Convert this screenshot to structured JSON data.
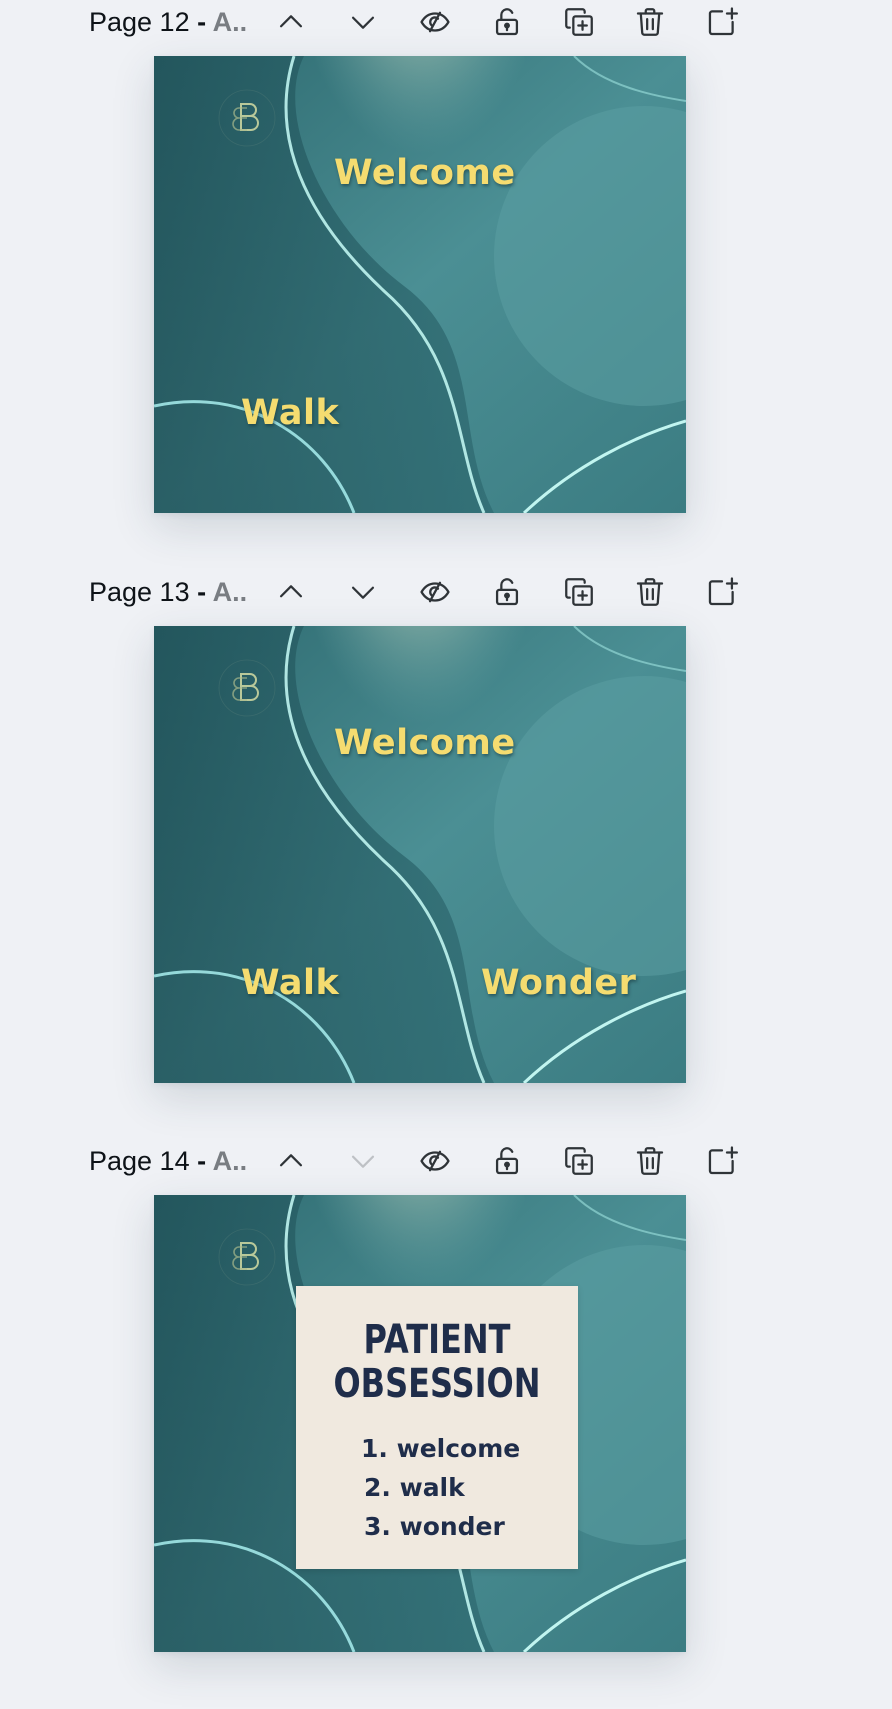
{
  "colors": {
    "background": "#eff1f5",
    "icon": "#2f3438",
    "icon_disabled": "#c4c7cb",
    "slide_text": "#f5dc70",
    "card_bg": "#f0e9df",
    "card_text": "#1f2d4a",
    "teal_dark": "#2f6b72",
    "teal_light": "#5fa3a8"
  },
  "icons": {
    "move_up": "chevron-up-icon",
    "move_down": "chevron-down-icon",
    "hide": "eye-slash-icon",
    "lock": "lock-open-icon",
    "duplicate": "duplicate-icon",
    "delete": "trash-icon",
    "add": "add-page-icon"
  },
  "pages": [
    {
      "label": "Page 12",
      "separator": " - ",
      "name": "A..",
      "move_down_disabled": false,
      "slide": {
        "welcome": "Welcome",
        "walk": "Walk",
        "wonder": ""
      }
    },
    {
      "label": "Page 13",
      "separator": " - ",
      "name": "A..",
      "move_down_disabled": false,
      "slide": {
        "welcome": "Welcome",
        "walk": "Walk",
        "wonder": "Wonder"
      }
    },
    {
      "label": "Page 14",
      "separator": " - ",
      "name": "A..",
      "move_down_disabled": true,
      "slide": {
        "card_title_line1": "PATIENT",
        "card_title_line2": "OBSESSION",
        "items": [
          "1. welcome",
          "2. walk",
          "3. wonder"
        ]
      }
    }
  ]
}
